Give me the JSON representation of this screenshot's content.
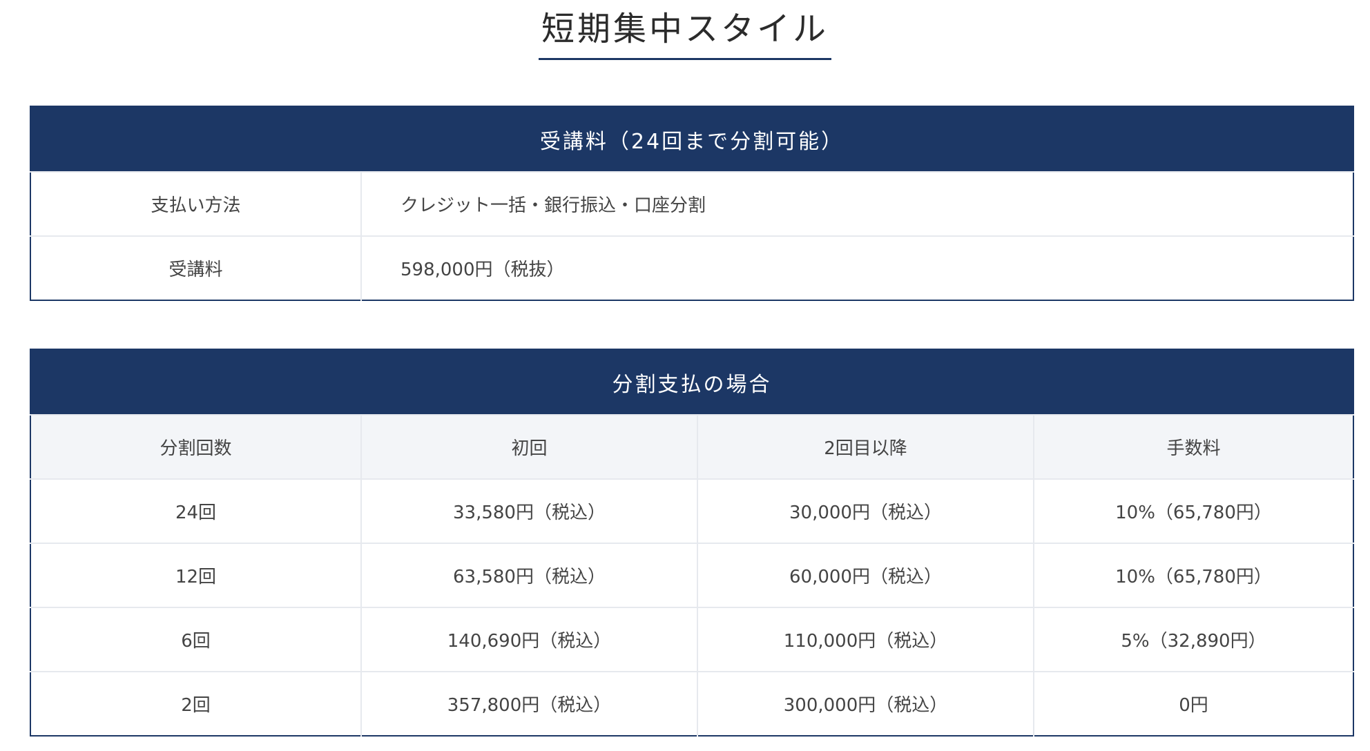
{
  "page_title": "短期集中スタイル",
  "fee_table": {
    "header": "受講料（24回まで分割可能）",
    "rows": [
      {
        "label": "支払い方法",
        "value": "クレジット一括・銀行振込・口座分割"
      },
      {
        "label": "受講料",
        "value": "598,000円（税抜）"
      }
    ]
  },
  "installment_table": {
    "header": "分割支払の場合",
    "columns": [
      "分割回数",
      "初回",
      "2回目以降",
      "手数料"
    ],
    "rows": [
      [
        "24回",
        "33,580円（税込）",
        "30,000円（税込）",
        "10%（65,780円）"
      ],
      [
        "12回",
        "63,580円（税込）",
        "60,000円（税込）",
        "10%（65,780円）"
      ],
      [
        "6回",
        "140,690円（税込）",
        "110,000円（税込）",
        "5%（32,890円）"
      ],
      [
        "2回",
        "357,800円（税込）",
        "300,000円（税込）",
        "0円"
      ]
    ]
  },
  "colors": {
    "header_bg": "#1c3765",
    "subheader_bg": "#f3f5f8",
    "cell_border": "#e6e9ee"
  }
}
